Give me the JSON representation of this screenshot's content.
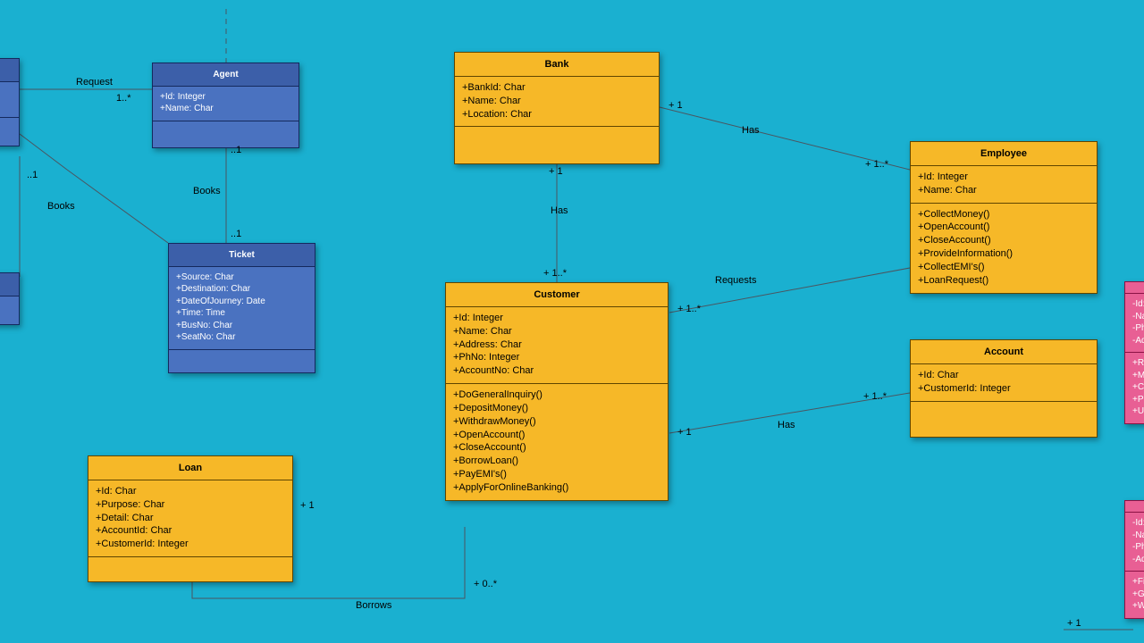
{
  "theme": {
    "bg": "#1ab0d0",
    "yellow": "#f6b828",
    "blue_head": "#3c5fa9",
    "blue_body": "#4a72c0",
    "pink": "#e85f94"
  },
  "classes": {
    "bank": {
      "title": "Bank",
      "attrs": [
        "+BankId: Char",
        "+Name: Char",
        "+Location: Char"
      ],
      "ops": []
    },
    "employee": {
      "title": "Employee",
      "attrs": [
        "+Id: Integer",
        "+Name: Char"
      ],
      "ops": [
        "+CollectMoney()",
        "+OpenAccount()",
        "+CloseAccount()",
        "+ProvideInformation()",
        "+CollectEMI's()",
        "+LoanRequest()"
      ]
    },
    "account": {
      "title": "Account",
      "attrs": [
        "+Id: Char",
        "+CustomerId: Integer"
      ],
      "ops": []
    },
    "customer": {
      "title": "Customer",
      "attrs": [
        "+Id: Integer",
        "+Name: Char",
        "+Address: Char",
        "+PhNo: Integer",
        "+AccountNo: Char"
      ],
      "ops": [
        "+DoGeneralInquiry()",
        "+DepositMoney()",
        "+WithdrawMoney()",
        "+OpenAccount()",
        "+CloseAccount()",
        "+BorrowLoan()",
        "+PayEMI's()",
        "+ApplyForOnlineBanking()"
      ]
    },
    "loan": {
      "title": "Loan",
      "attrs": [
        "+Id: Char",
        "+Purpose: Char",
        "+Detail: Char",
        "+AccountId: Char",
        "+CustomerId: Integer"
      ],
      "ops": []
    },
    "agent": {
      "title": "Agent",
      "attrs": [
        "+Id: Integer",
        "+Name: Char"
      ],
      "ops": []
    },
    "ticket": {
      "title": "Ticket",
      "attrs": [
        "+Source: Char",
        "+Destination: Char",
        "+DateOfJourney: Date",
        "+Time: Time",
        "+BusNo: Char",
        "+SeatNo: Char"
      ],
      "ops": []
    },
    "pink_a": {
      "title": "",
      "attrs": [
        "-Id: Ch",
        "-Name:",
        "-PhNo:",
        "-Addre"
      ],
      "ops": [
        "+Repair",
        "+Mainte",
        "+Check",
        "+Prepar",
        "+Update"
      ]
    },
    "pink_b": {
      "title": "",
      "attrs": [
        "-Id: Ch",
        "-Name:",
        "-PhNo:",
        "-Addre"
      ],
      "ops": [
        "+FillAd()",
        "+GetLa()",
        "+Write()"
      ]
    }
  },
  "labels": {
    "request_left": "Request",
    "books_left": "Books",
    "books_right": "Books",
    "has_center": "Has",
    "has_top": "Has",
    "has_right": "Has",
    "requests_right": "Requests",
    "borrows": "Borrows"
  },
  "multiplicities": {
    "req_left_top": "1..*",
    "top_blue_a": "..1",
    "top_blue_b": "..1",
    "left_books_a": "..1",
    "cust_top": "+ 1..*",
    "bank_top": "+ 1",
    "bank_has_a": "+ 1",
    "emp_has_b": "+ 1..*",
    "cust_req_a": "+ 1..*",
    "cust_has_a": "+ 1",
    "acct_has_b": "+ 1..*",
    "loan_borrows": "+ 1",
    "cust_borrows": "+ 0..*",
    "pink_mult": "+ 1"
  }
}
